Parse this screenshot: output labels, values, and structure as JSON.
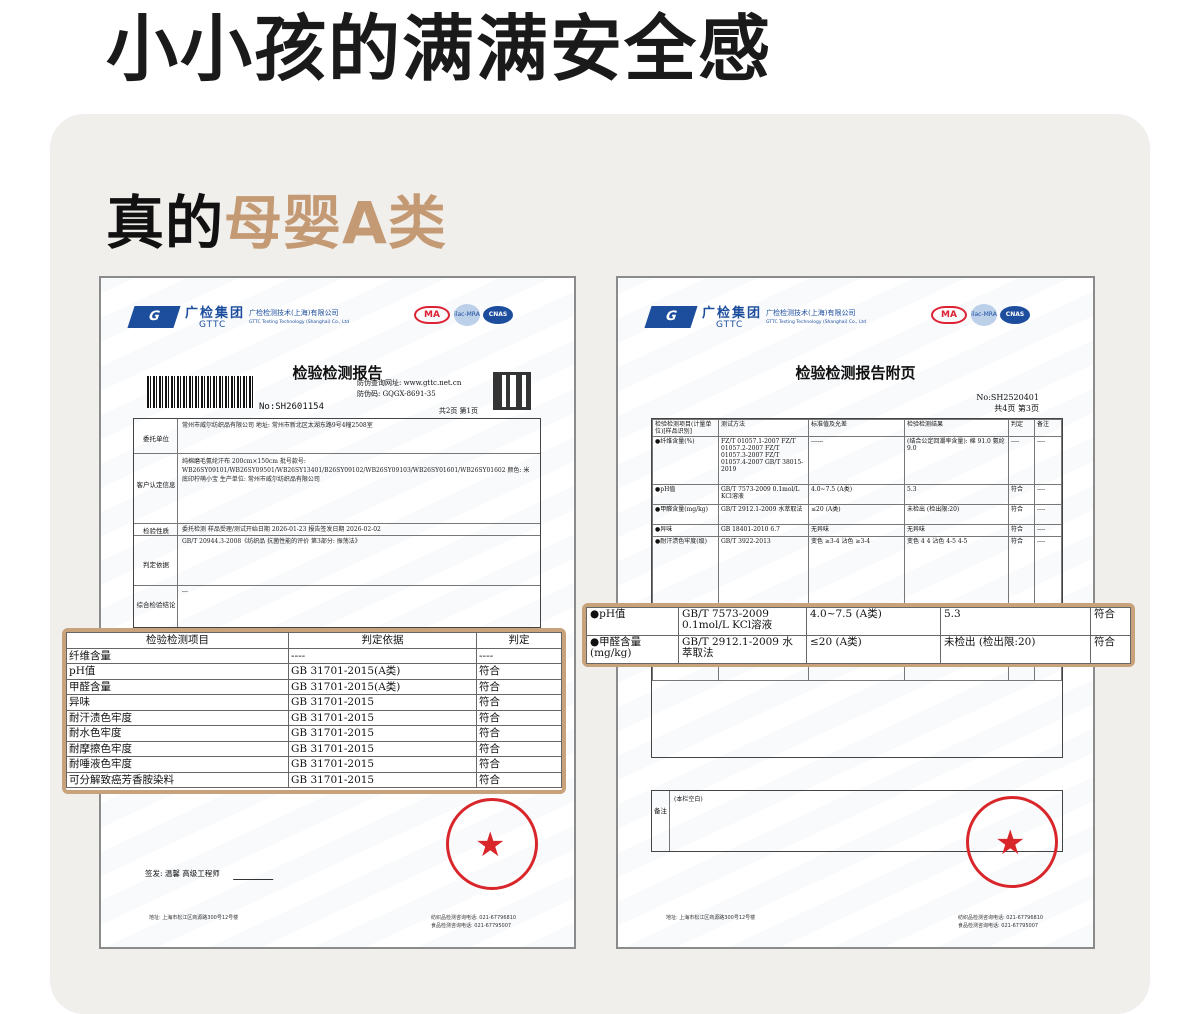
{
  "headline": "小小孩的满满安全感",
  "subtitle": {
    "prefix": "真的",
    "highlight": "母婴A类"
  },
  "colors": {
    "accent": "#c39a74",
    "panel": "#f1efec",
    "stamp_red": "#d8262b",
    "brand_blue": "#1d4e9e"
  },
  "report": {
    "brand": "广检集团",
    "brand_en": "GTTC",
    "company": "广检检测技术(上海)有限公司",
    "company_en": "GTTC Testing Technology (Shanghai) Co., Ltd",
    "cert_ma": "MA",
    "cert_ilac": "ilac-MRA",
    "cert_cnas": "CNAS",
    "title": "检验检测报告",
    "anti_line1": "防伪查询网址: www.gttc.net.cn",
    "anti_line2": "防伪码: GQGX-8691-35",
    "report_no": "No:SH2601154",
    "pages": "共2页 第1页",
    "rows": [
      {
        "label": "委托单位",
        "text": "常州市威尔纺织品有限公司 地址: 常州市新北区太湖东路9号4幢2508室"
      },
      {
        "label": "客户认定信息",
        "text": "纯棉磨毛氨纶汗布 200cm×150cm 批号款号: WB26SY09101/WB26SY09501/WB26SY13401/B26SY09102/WB26SY09103/WB26SY01601/WB26SY01602 颜色: 米底印柠萌小宝 生产单位: 常州市威尔纺织品有限公司"
      },
      {
        "label": "检验性质",
        "text": "委托检测  样品受理/测试开始日期 2026-01-23  报告签发日期 2026-02-02"
      },
      {
        "label": "判定依据",
        "text": "GB/T 20944.3-2008《纺织品 抗菌性能的评价 第3部分: 振荡法》"
      },
      {
        "label": "综合检验结论",
        "text": "---"
      }
    ],
    "signature": "签发: 温馨 高级工程师",
    "footer_left": "地址: 上海市松江区商源路300号12号楼",
    "footer_right1": "纺织品检测咨询电话: 021-67796810",
    "footer_right2": "食品检测咨询电话: 021-67795007",
    "stamp_top": "广检检测技术(上海)有限公司",
    "stamp_bottom": "检验检测专用章"
  },
  "highlight_table": {
    "headers": [
      "检验检测项目",
      "判定依据",
      "判定"
    ],
    "rows": [
      [
        "纤维含量",
        "----",
        "----"
      ],
      [
        "pH值",
        "GB 31701-2015(A类)",
        "符合"
      ],
      [
        "甲醛含量",
        "GB 31701-2015(A类)",
        "符合"
      ],
      [
        "异味",
        "GB 31701-2015",
        "符合"
      ],
      [
        "耐汗渍色牢度",
        "GB 31701-2015",
        "符合"
      ],
      [
        "耐水色牢度",
        "GB 31701-2015",
        "符合"
      ],
      [
        "耐摩擦色牢度",
        "GB 31701-2015",
        "符合"
      ],
      [
        "耐唾液色牢度",
        "GB 31701-2015",
        "符合"
      ],
      [
        "可分解致癌芳香胺染料",
        "GB 31701-2015",
        "符合"
      ]
    ]
  },
  "appendix": {
    "title": "检验检测报告附页",
    "report_no": "No:SH2520401",
    "pages": "共4页 第3页",
    "headers": [
      "检验检测项目(计量单位)[样品识别]",
      "测试方法",
      "标准值及允差",
      "检验检测结果",
      "判定",
      "备注"
    ],
    "rows": [
      [
        "●纤维含量(%)",
        "FZ/T 01057.1-2007 FZ/T 01057.2-2007 FZ/T 01057.3-2007 FZ/T 01057.4-2007 GB/T 38015-2019",
        "------",
        "(结合公定回潮率含量): 棉 91.0 氨纶 9.0",
        "----",
        "----"
      ],
      [
        "●pH值",
        "GB/T 7573-2009 0.1mol/L KCl溶液",
        "4.0~7.5 (A类)",
        "5.3",
        "符合",
        "----"
      ],
      [
        "●甲醛含量(mg/kg)",
        "GB/T 2912.1-2009 水萃取法",
        "≤20 (A类)",
        "未检出 (检出限:20)",
        "符合",
        "----"
      ],
      [
        "●异味",
        "GB 18401-2010 6.7",
        "无异味",
        "无异味",
        "符合",
        "----"
      ],
      [
        "●耐汗渍色牢度(级)",
        "GB/T 3922-2013",
        "变色 ≥3-4 沾色 ≥3-4",
        "变色 4 4 沾色 4-5 4-5",
        "符合",
        "----"
      ],
      [
        "●耐唾液色牢度(级)",
        "GB/T 18886-2019",
        "变色 ≥4 沾色 ≥4",
        "变色 4 沾色 4-5",
        "符合",
        "----"
      ]
    ],
    "remarks_label": "备注",
    "remarks_text": "(本栏空白)",
    "footer_left": "地址: 上海市松江区商源路300号12号楼",
    "footer_right1": "纺织品检测咨询电话: 021-67796810",
    "footer_right2": "食品检测咨询电话: 021-67795007",
    "stamp_top": "广检检测技术(上海)有限公司",
    "stamp_bottom": "检验检测专用章"
  },
  "highlight_table2": {
    "rows": [
      [
        "●pH值",
        "GB/T 7573-2009 0.1mol/L KCl溶液",
        "4.0~7.5 (A类)",
        "5.3",
        "符合"
      ],
      [
        "●甲醛含量 (mg/kg)",
        "GB/T 2912.1-2009 水萃取法",
        "≤20 (A类)",
        "未检出 (检出限:20)",
        "符合"
      ]
    ]
  }
}
